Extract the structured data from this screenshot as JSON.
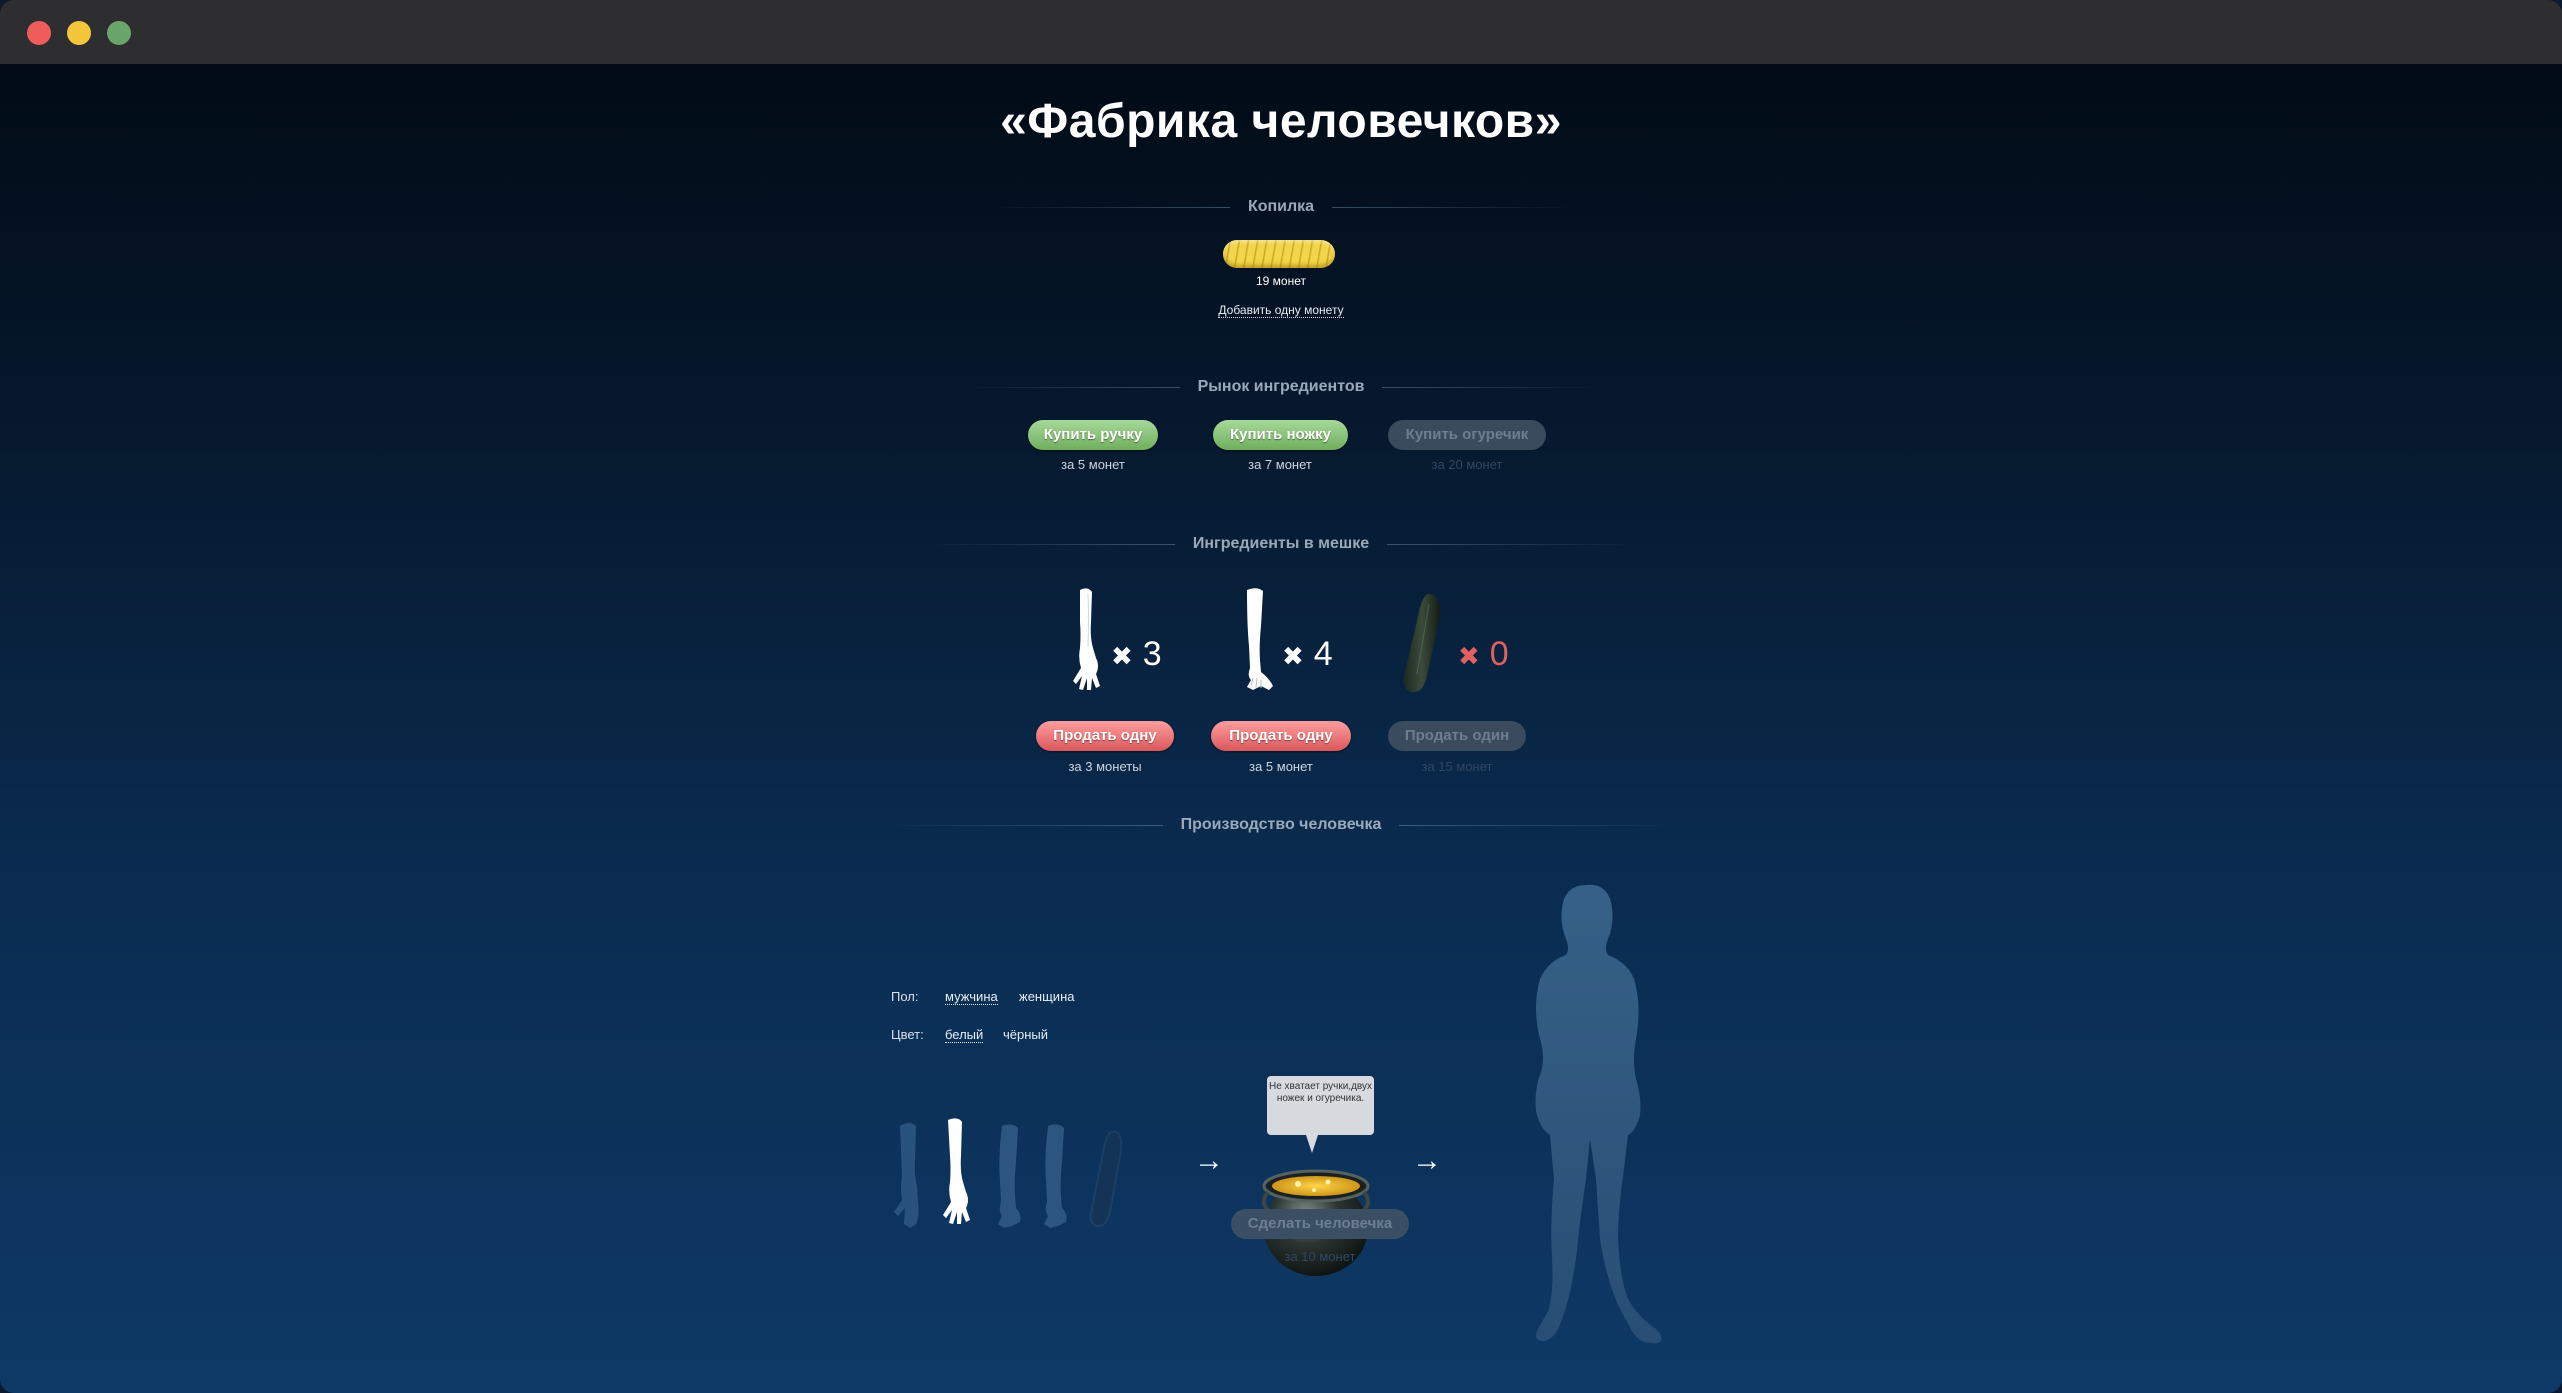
{
  "page": {
    "title": "«Фабрика человечков»"
  },
  "bank": {
    "section_label": "Копилка",
    "coins_text": "19 монет",
    "add_coin_label": "Добавить одну монету"
  },
  "market": {
    "section_label": "Рынок ингредиентов",
    "items": [
      {
        "button": "Купить ручку",
        "price": "за 5 монет",
        "enabled": true
      },
      {
        "button": "Купить ножку",
        "price": "за 7 монет",
        "enabled": true
      },
      {
        "button": "Купить огуречик",
        "price": "за 20 монет",
        "enabled": false
      }
    ]
  },
  "bag": {
    "section_label": "Ингредиенты в мешке",
    "items": [
      {
        "icon": "arm-icon",
        "multiplier": "✖",
        "count": "3",
        "button": "Продать одну",
        "price": "за 3 монеты",
        "enabled": true
      },
      {
        "icon": "leg-icon",
        "multiplier": "✖",
        "count": "4",
        "button": "Продать одну",
        "price": "за 5 монет",
        "enabled": true
      },
      {
        "icon": "cucumber-icon",
        "multiplier": "✖",
        "count": "0",
        "button": "Продать один",
        "price": "за 15 монет",
        "enabled": false
      }
    ]
  },
  "production": {
    "section_label": "Производство человечка",
    "gender_label": "Пол:",
    "gender_options": [
      "мужчина",
      "женщина"
    ],
    "color_label": "Цвет:",
    "color_options": [
      "белый",
      "чёрный"
    ],
    "hint_bubble": "Не хватает ручки,двух ножек и огуречика.",
    "make_button": "Сделать человечка",
    "make_price": "за 10 монет",
    "arrow_glyph": "→"
  },
  "colors": {
    "accent_green": "#6fae5d",
    "accent_red": "#d9585c",
    "coin_gold": "#f1d64a"
  }
}
